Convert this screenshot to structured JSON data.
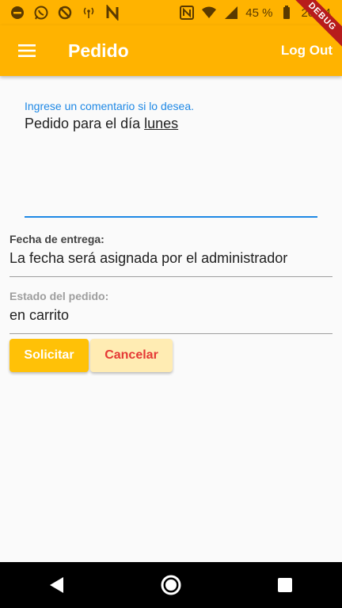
{
  "status_bar": {
    "battery_percent": "45 %",
    "time": "20:14",
    "icons": [
      "minus-circle-icon",
      "whatsapp-icon",
      "data-saver-icon",
      "hotspot-icon",
      "n-icon",
      "nfc-icon",
      "wifi-icon",
      "signal-icon",
      "battery-icon"
    ]
  },
  "debug_banner": "DEBUG",
  "app_bar": {
    "title": "Pedido",
    "logout_label": "Log Out",
    "background": "#ffb300"
  },
  "comment": {
    "label": "Ingrese un comentario si lo desea.",
    "value_prefix": "Pedido para el día ",
    "value_underlined": "lunes",
    "accent": "#1e88e5"
  },
  "fecha": {
    "label": "Fecha de entrega:",
    "value": "La fecha será asignada por el administrador"
  },
  "estado": {
    "label": "Estado del pedido:",
    "value": "en carrito"
  },
  "buttons": {
    "solicitar": "Solicitar",
    "cancelar": "Cancelar"
  },
  "nav": [
    "back-icon",
    "home-icon",
    "recents-icon"
  ]
}
